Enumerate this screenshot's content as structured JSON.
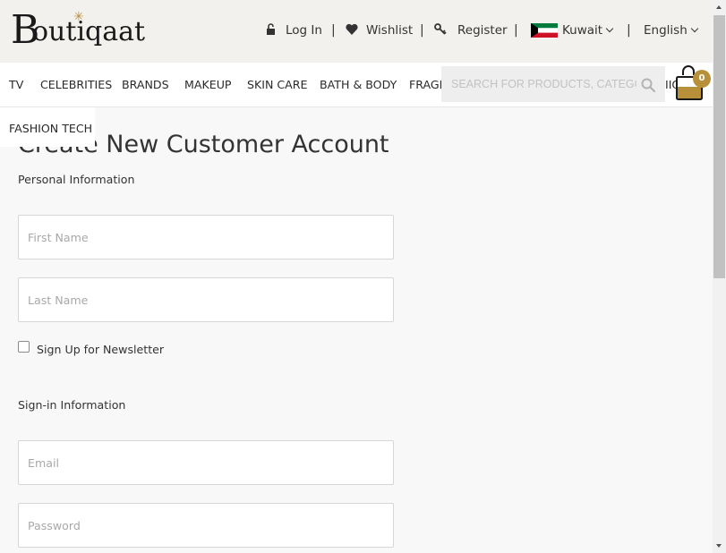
{
  "brand": {
    "name": "Boutiqaat",
    "b_glyph": "B",
    "rest": "outiqaat"
  },
  "header": {
    "login_label": "Log In",
    "wishlist_label": "Wishlist",
    "register_label": "Register",
    "country_label": "Kuwait",
    "language_label": "English",
    "separator": "|"
  },
  "nav": {
    "items": [
      "TV",
      "CELEBRITIES",
      "BRANDS",
      "MAKEUP",
      "SKIN CARE",
      "BATH & BODY",
      "FRAGR",
      "IION"
    ],
    "search_placeholder": "SEARCH FOR PRODUCTS, CATEGORIES",
    "cart_count": "0",
    "dropdown_item": "FASHION TECH"
  },
  "form": {
    "title": "Create New Customer Account",
    "personal_section": "Personal Information",
    "first_name_placeholder": "First Name",
    "last_name_placeholder": "Last Name",
    "newsletter_label": "Sign Up for Newsletter",
    "signin_section": "Sign-in Information",
    "email_placeholder": "Email",
    "password_placeholder": "Password"
  },
  "colors": {
    "accent_gold": "#b8903a",
    "topbar_bg": "#f3f1ee",
    "page_bg": "#f8f8f8"
  },
  "icons": [
    "lock-icon",
    "heart-icon",
    "key-icon",
    "kuwait-flag-icon",
    "chevron-down-icon",
    "search-icon",
    "shopping-bag-icon"
  ]
}
